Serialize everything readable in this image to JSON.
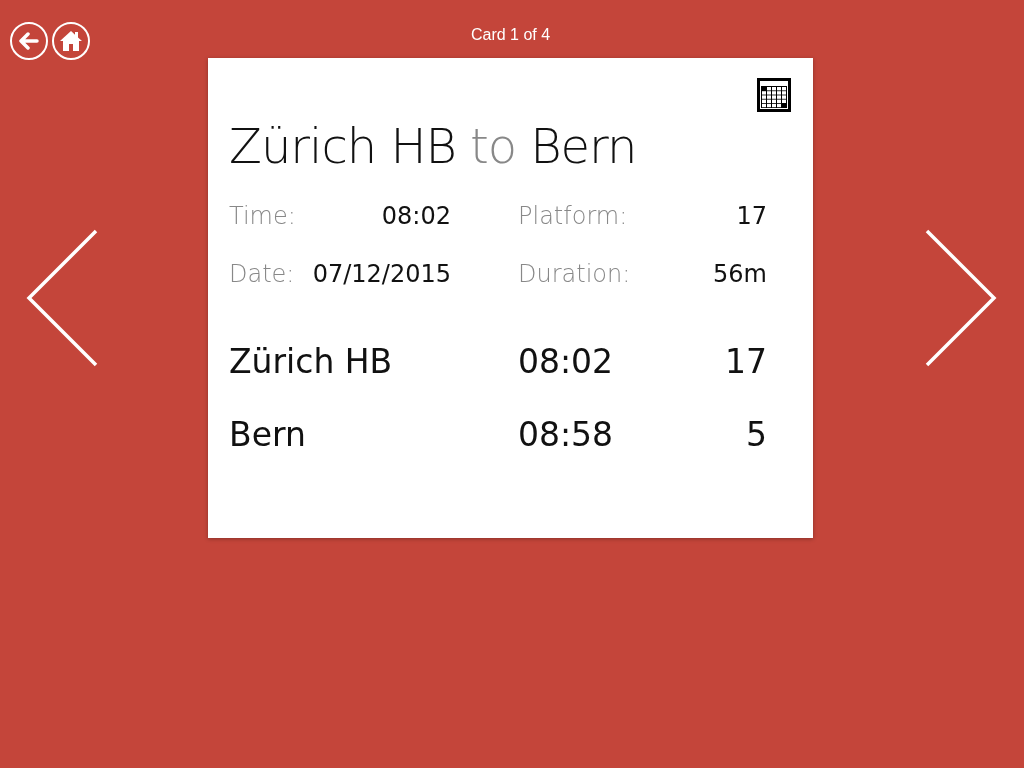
{
  "header": {
    "title": "Card 1 of 4"
  },
  "card": {
    "title": {
      "from": "Zürich HB",
      "connector": "to",
      "to": "Bern"
    },
    "details": [
      {
        "label": "Time:",
        "value": "08:02"
      },
      {
        "label": "Platform:",
        "value": "17"
      },
      {
        "label": "Date:",
        "value": "07/12/2015"
      },
      {
        "label": "Duration:",
        "value": "56m"
      }
    ],
    "stops": [
      {
        "station": "Zürich HB",
        "time": "08:02",
        "platform": "17"
      },
      {
        "station": "Bern",
        "time": "08:58",
        "platform": "5"
      }
    ]
  }
}
